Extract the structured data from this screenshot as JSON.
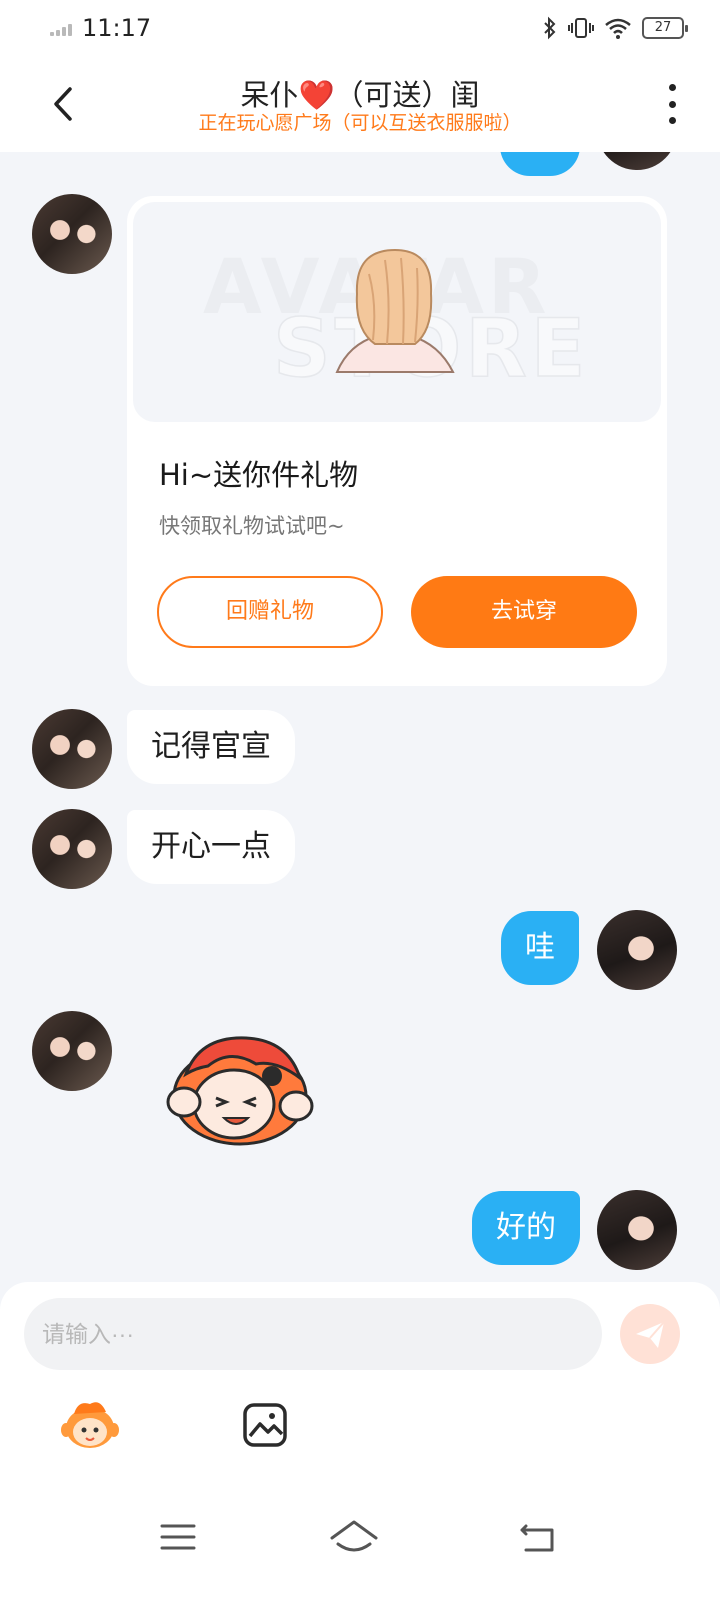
{
  "status_bar": {
    "time": "11:17",
    "battery": "27"
  },
  "header": {
    "title": "呆仆❤️（可送）闺",
    "subtitle": "正在玩心愿广场（可以互送衣服服啦）"
  },
  "gift_card": {
    "watermark_line1": "AVATAR",
    "watermark_line2": "STORE",
    "title": "Hi~送你件礼物",
    "subtitle": "快领取礼物试试吧~",
    "return_gift_label": "回赠礼物",
    "try_on_label": "去试穿"
  },
  "messages": [
    {
      "side": "left",
      "text": "记得官宣"
    },
    {
      "side": "left",
      "text": "开心一点"
    },
    {
      "side": "right",
      "text": "哇"
    },
    {
      "side": "left",
      "type": "sticker"
    },
    {
      "side": "right",
      "text": "好的"
    }
  ],
  "input": {
    "placeholder": "请输入···"
  },
  "colors": {
    "accent": "#ff7a14",
    "bubble_right": "#2ab0f4",
    "background": "#f3f5f9"
  },
  "icons": {
    "back": "chevron-left-icon",
    "more": "more-vertical-icon",
    "send": "send-icon",
    "emoji": "monkey-emoji-icon",
    "image": "image-icon",
    "nav_menu": "menu-icon",
    "nav_home": "home-icon",
    "nav_back": "back-icon"
  }
}
